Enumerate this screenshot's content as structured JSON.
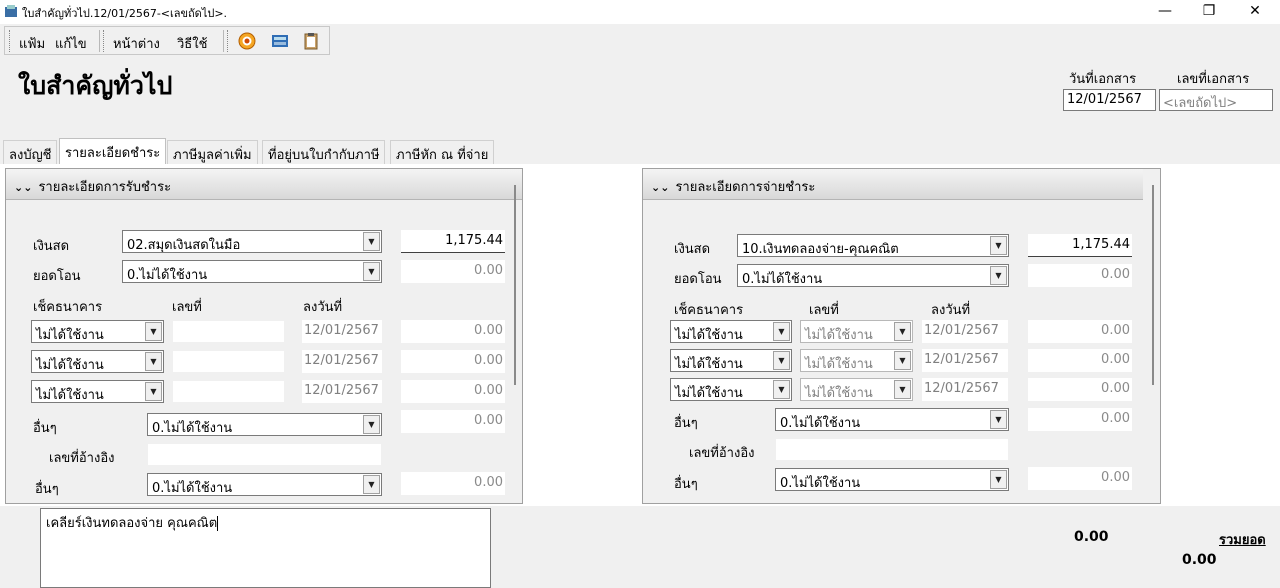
{
  "window": {
    "title": "ใบสำคัญทั่วไป.12/01/2567-<เลขถัดไป>.",
    "min": "—",
    "max": "❐",
    "close": "✕"
  },
  "menu": {
    "file": "แฟ้ม",
    "edit": "แก้ไข",
    "window": "หน้าต่าง",
    "help": "วิธีใช้"
  },
  "header": {
    "title": "ใบสำคัญทั่วไป",
    "date_label": "วันที่เอกสาร",
    "docno_label": "เลขที่เอกสาร",
    "date_value": "12/01/2567",
    "docno_placeholder": "<เลขถัดไป>"
  },
  "tabs": [
    "ลงบัญชี",
    "รายละเอียดชำระ",
    "ภาษีมูลค่าเพิ่ม",
    "ที่อยู่บนใบกำกับภาษี",
    "ภาษีหัก ณ ที่จ่าย"
  ],
  "receive": {
    "title": "รายละเอียดการรับชำระ",
    "cash_label": "เงินสด",
    "cash_account": "02.สมุดเงินสดในมือ",
    "cash_amount": "1,175.44",
    "transfer_label": "ยอดโอน",
    "transfer_account": "0.ไม่ได้ใช้งาน",
    "transfer_amount": "0.00",
    "cheque_label": "เช็คธนาคาร",
    "no_label": "เลขที่",
    "date_label": "ลงวันที่",
    "cheques": [
      {
        "bank": "ไม่ได้ใช้งาน",
        "no": "",
        "date": "12/01/2567",
        "amount": "0.00"
      },
      {
        "bank": "ไม่ได้ใช้งาน",
        "no": "",
        "date": "12/01/2567",
        "amount": "0.00"
      },
      {
        "bank": "ไม่ได้ใช้งาน",
        "no": "",
        "date": "12/01/2567",
        "amount": "0.00"
      }
    ],
    "other_label": "อื่นๆ",
    "other_account": "0.ไม่ได้ใช้งาน",
    "other_amount": "0.00",
    "ref_label": "เลขที่อ้างอิง",
    "other2_label": "อื่นๆ",
    "other2_account": "0.ไม่ได้ใช้งาน",
    "other2_amount": "0.00"
  },
  "pay": {
    "title": "รายละเอียดการจ่ายชำระ",
    "cash_label": "เงินสด",
    "cash_account": "10.เงินทดลองจ่าย-คุณคณิต",
    "cash_amount": "1,175.44",
    "transfer_label": "ยอดโอน",
    "transfer_account": "0.ไม่ได้ใช้งาน",
    "transfer_amount": "0.00",
    "cheque_label": "เช็คธนาคาร",
    "no_label": "เลขที่",
    "date_label": "ลงวันที่",
    "cheques": [
      {
        "bank": "ไม่ได้ใช้งาน",
        "no": "ไม่ได้ใช้งาน",
        "date": "12/01/2567",
        "amount": "0.00"
      },
      {
        "bank": "ไม่ได้ใช้งาน",
        "no": "ไม่ได้ใช้งาน",
        "date": "12/01/2567",
        "amount": "0.00"
      },
      {
        "bank": "ไม่ได้ใช้งาน",
        "no": "ไม่ได้ใช้งาน",
        "date": "12/01/2567",
        "amount": "0.00"
      }
    ],
    "other_label": "อื่นๆ",
    "other_account": "0.ไม่ได้ใช้งาน",
    "other_amount": "0.00",
    "ref_label": "เลขที่อ้างอิง",
    "other2_label": "อื่นๆ",
    "other2_account": "0.ไม่ได้ใช้งาน",
    "other2_amount": "0.00"
  },
  "memo": "เคลียร์เงินทดลองจ่าย คุณคณิต",
  "summary": {
    "amount1": "0.00",
    "total_link": "รวมยอด",
    "amount2": "0.00"
  }
}
